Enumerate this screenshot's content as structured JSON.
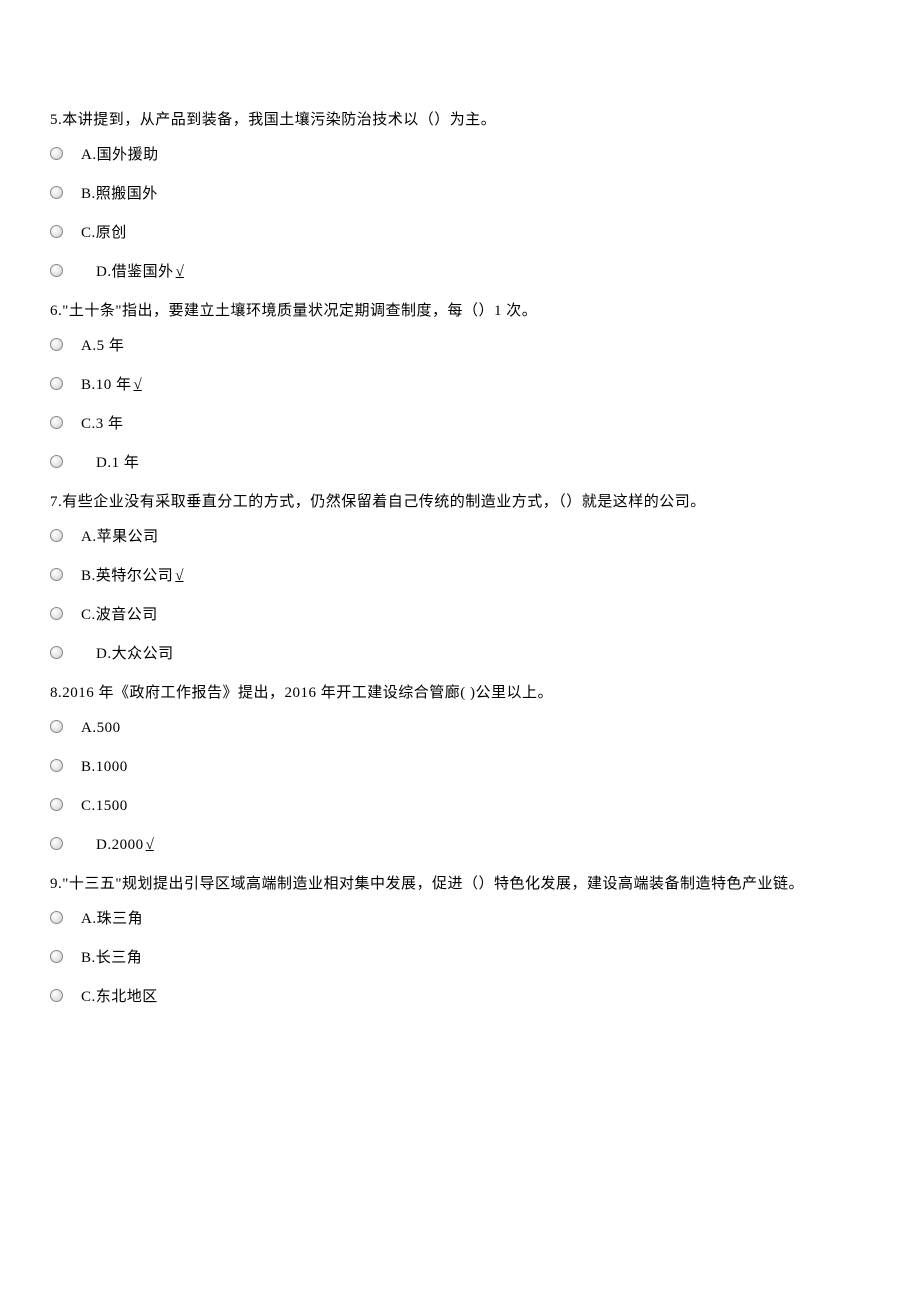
{
  "questions": [
    {
      "number": "5.",
      "text": "本讲提到，从产品到装备，我国土壤污染防治技术以（）为主。",
      "options": [
        {
          "label": "A.国外援助",
          "correct": false,
          "indent": false
        },
        {
          "label": "B.照搬国外",
          "correct": false,
          "indent": false
        },
        {
          "label": "C.原创",
          "correct": false,
          "indent": false
        },
        {
          "label": "D.借鉴国外",
          "correct": true,
          "indent": true
        }
      ]
    },
    {
      "number": "6.",
      "text": "\"土十条\"指出，要建立土壤环境质量状况定期调查制度，每（）1 次。",
      "options": [
        {
          "label": "A.5 年",
          "correct": false,
          "indent": false
        },
        {
          "label": "B.10 年",
          "correct": true,
          "indent": false
        },
        {
          "label": "C.3 年",
          "correct": false,
          "indent": false
        },
        {
          "label": "D.1 年",
          "correct": false,
          "indent": true
        }
      ]
    },
    {
      "number": "7.",
      "text": "有些企业没有采取垂直分工的方式，仍然保留着自己传统的制造业方式，（）就是这样的公司。",
      "options": [
        {
          "label": "A.苹果公司",
          "correct": false,
          "indent": false
        },
        {
          "label": "B.英特尔公司",
          "correct": true,
          "indent": false
        },
        {
          "label": "C.波音公司",
          "correct": false,
          "indent": false
        },
        {
          "label": "D.大众公司",
          "correct": false,
          "indent": true
        }
      ]
    },
    {
      "number": "8.",
      "text": "2016 年《政府工作报告》提出，2016 年开工建设综合管廊(  )公里以上。",
      "options": [
        {
          "label": "A.500",
          "correct": false,
          "indent": false
        },
        {
          "label": "B.1000",
          "correct": false,
          "indent": false
        },
        {
          "label": "C.1500",
          "correct": false,
          "indent": false
        },
        {
          "label": "D.2000",
          "correct": true,
          "indent": true
        }
      ]
    },
    {
      "number": "9.",
      "text": "\"十三五\"规划提出引导区域高端制造业相对集中发展，促进（）特色化发展，建设高端装备制造特色产业链。",
      "options": [
        {
          "label": "A.珠三角",
          "correct": false,
          "indent": false
        },
        {
          "label": "B.长三角",
          "correct": false,
          "indent": false
        },
        {
          "label": "C.东北地区",
          "correct": false,
          "indent": false
        }
      ]
    }
  ],
  "checkMark": "√"
}
